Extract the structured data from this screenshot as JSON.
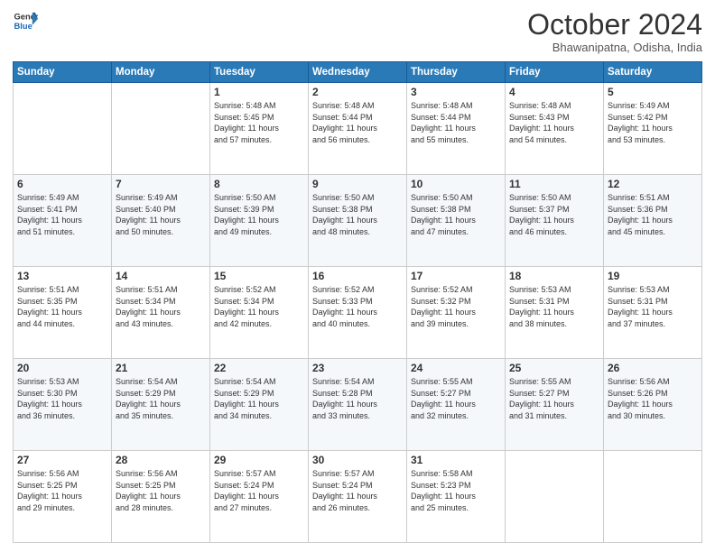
{
  "logo": {
    "line1": "General",
    "line2": "Blue"
  },
  "header": {
    "month": "October 2024",
    "location": "Bhawanipatna, Odisha, India"
  },
  "weekdays": [
    "Sunday",
    "Monday",
    "Tuesday",
    "Wednesday",
    "Thursday",
    "Friday",
    "Saturday"
  ],
  "weeks": [
    [
      {
        "day": "",
        "info": ""
      },
      {
        "day": "",
        "info": ""
      },
      {
        "day": "1",
        "info": "Sunrise: 5:48 AM\nSunset: 5:45 PM\nDaylight: 11 hours\nand 57 minutes."
      },
      {
        "day": "2",
        "info": "Sunrise: 5:48 AM\nSunset: 5:44 PM\nDaylight: 11 hours\nand 56 minutes."
      },
      {
        "day": "3",
        "info": "Sunrise: 5:48 AM\nSunset: 5:44 PM\nDaylight: 11 hours\nand 55 minutes."
      },
      {
        "day": "4",
        "info": "Sunrise: 5:48 AM\nSunset: 5:43 PM\nDaylight: 11 hours\nand 54 minutes."
      },
      {
        "day": "5",
        "info": "Sunrise: 5:49 AM\nSunset: 5:42 PM\nDaylight: 11 hours\nand 53 minutes."
      }
    ],
    [
      {
        "day": "6",
        "info": "Sunrise: 5:49 AM\nSunset: 5:41 PM\nDaylight: 11 hours\nand 51 minutes."
      },
      {
        "day": "7",
        "info": "Sunrise: 5:49 AM\nSunset: 5:40 PM\nDaylight: 11 hours\nand 50 minutes."
      },
      {
        "day": "8",
        "info": "Sunrise: 5:50 AM\nSunset: 5:39 PM\nDaylight: 11 hours\nand 49 minutes."
      },
      {
        "day": "9",
        "info": "Sunrise: 5:50 AM\nSunset: 5:38 PM\nDaylight: 11 hours\nand 48 minutes."
      },
      {
        "day": "10",
        "info": "Sunrise: 5:50 AM\nSunset: 5:38 PM\nDaylight: 11 hours\nand 47 minutes."
      },
      {
        "day": "11",
        "info": "Sunrise: 5:50 AM\nSunset: 5:37 PM\nDaylight: 11 hours\nand 46 minutes."
      },
      {
        "day": "12",
        "info": "Sunrise: 5:51 AM\nSunset: 5:36 PM\nDaylight: 11 hours\nand 45 minutes."
      }
    ],
    [
      {
        "day": "13",
        "info": "Sunrise: 5:51 AM\nSunset: 5:35 PM\nDaylight: 11 hours\nand 44 minutes."
      },
      {
        "day": "14",
        "info": "Sunrise: 5:51 AM\nSunset: 5:34 PM\nDaylight: 11 hours\nand 43 minutes."
      },
      {
        "day": "15",
        "info": "Sunrise: 5:52 AM\nSunset: 5:34 PM\nDaylight: 11 hours\nand 42 minutes."
      },
      {
        "day": "16",
        "info": "Sunrise: 5:52 AM\nSunset: 5:33 PM\nDaylight: 11 hours\nand 40 minutes."
      },
      {
        "day": "17",
        "info": "Sunrise: 5:52 AM\nSunset: 5:32 PM\nDaylight: 11 hours\nand 39 minutes."
      },
      {
        "day": "18",
        "info": "Sunrise: 5:53 AM\nSunset: 5:31 PM\nDaylight: 11 hours\nand 38 minutes."
      },
      {
        "day": "19",
        "info": "Sunrise: 5:53 AM\nSunset: 5:31 PM\nDaylight: 11 hours\nand 37 minutes."
      }
    ],
    [
      {
        "day": "20",
        "info": "Sunrise: 5:53 AM\nSunset: 5:30 PM\nDaylight: 11 hours\nand 36 minutes."
      },
      {
        "day": "21",
        "info": "Sunrise: 5:54 AM\nSunset: 5:29 PM\nDaylight: 11 hours\nand 35 minutes."
      },
      {
        "day": "22",
        "info": "Sunrise: 5:54 AM\nSunset: 5:29 PM\nDaylight: 11 hours\nand 34 minutes."
      },
      {
        "day": "23",
        "info": "Sunrise: 5:54 AM\nSunset: 5:28 PM\nDaylight: 11 hours\nand 33 minutes."
      },
      {
        "day": "24",
        "info": "Sunrise: 5:55 AM\nSunset: 5:27 PM\nDaylight: 11 hours\nand 32 minutes."
      },
      {
        "day": "25",
        "info": "Sunrise: 5:55 AM\nSunset: 5:27 PM\nDaylight: 11 hours\nand 31 minutes."
      },
      {
        "day": "26",
        "info": "Sunrise: 5:56 AM\nSunset: 5:26 PM\nDaylight: 11 hours\nand 30 minutes."
      }
    ],
    [
      {
        "day": "27",
        "info": "Sunrise: 5:56 AM\nSunset: 5:25 PM\nDaylight: 11 hours\nand 29 minutes."
      },
      {
        "day": "28",
        "info": "Sunrise: 5:56 AM\nSunset: 5:25 PM\nDaylight: 11 hours\nand 28 minutes."
      },
      {
        "day": "29",
        "info": "Sunrise: 5:57 AM\nSunset: 5:24 PM\nDaylight: 11 hours\nand 27 minutes."
      },
      {
        "day": "30",
        "info": "Sunrise: 5:57 AM\nSunset: 5:24 PM\nDaylight: 11 hours\nand 26 minutes."
      },
      {
        "day": "31",
        "info": "Sunrise: 5:58 AM\nSunset: 5:23 PM\nDaylight: 11 hours\nand 25 minutes."
      },
      {
        "day": "",
        "info": ""
      },
      {
        "day": "",
        "info": ""
      }
    ]
  ]
}
